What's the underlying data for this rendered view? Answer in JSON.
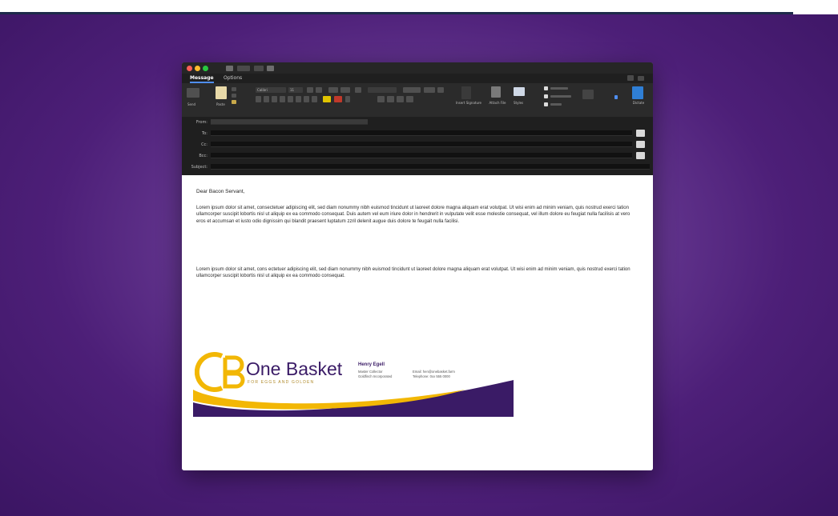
{
  "window": {
    "tabs": [
      "Message",
      "Options"
    ],
    "field_labels": [
      "From:",
      "To:",
      "Cc:",
      "Bcc:",
      "Subject:"
    ]
  },
  "ribbon": {
    "paste_label": "Paste",
    "font_name": "Calibri",
    "font_size": "11",
    "group_labels": [
      "Insert Signature",
      "Attach File",
      "Styles",
      "Dictate"
    ]
  },
  "email": {
    "greeting": "Dear Bacon Servant,",
    "paragraph1": "Lorem ipsum dolor sit amet, consectetuer adipiscing elit, sed diam nonummy nibh euismod tincidunt ut laoreet dolore magna aliquam erat volutpat. Ut wisi enim ad minim veniam, quis nostrud exerci tation ullamcorper suscipit lobortis nisl ut aliquip ex ea commodo consequat. Duis autem vel eum iriure dolor in hendrerit in vulputate velit esse molestie consequat, vel illum dolore eu feugiat nulla facilisis at vero eros et accumsan et iusto odio dignissim qui blandit praesent luptatum zzril delenit augue duis dolore te feugait nulla facilisi.",
    "paragraph2": "Lorem ipsum dolor sit amet, cons ectetuer adipiscing elit, sed diam nonummy nibh euismod tincidunt ut laoreet dolore magna aliquam erat volutpat. Ut wisi enim ad minim veniam, quis nostrud exerci tation ullamcorper suscipit lobortis nisl ut aliquip ex ea commodo consequat."
  },
  "signature": {
    "brand": "One Basket",
    "tagline": "FOR EGGS AND GOLDEN",
    "name": "Henry Egell",
    "title": "Master Collector",
    "company": "Goldfinch Incorporated",
    "email": "Email: hen@onebasket.farm",
    "phone": "Telephone: 0xx 555 0000",
    "colors": {
      "purple": "#3a1b66",
      "gold": "#f2b705"
    }
  }
}
